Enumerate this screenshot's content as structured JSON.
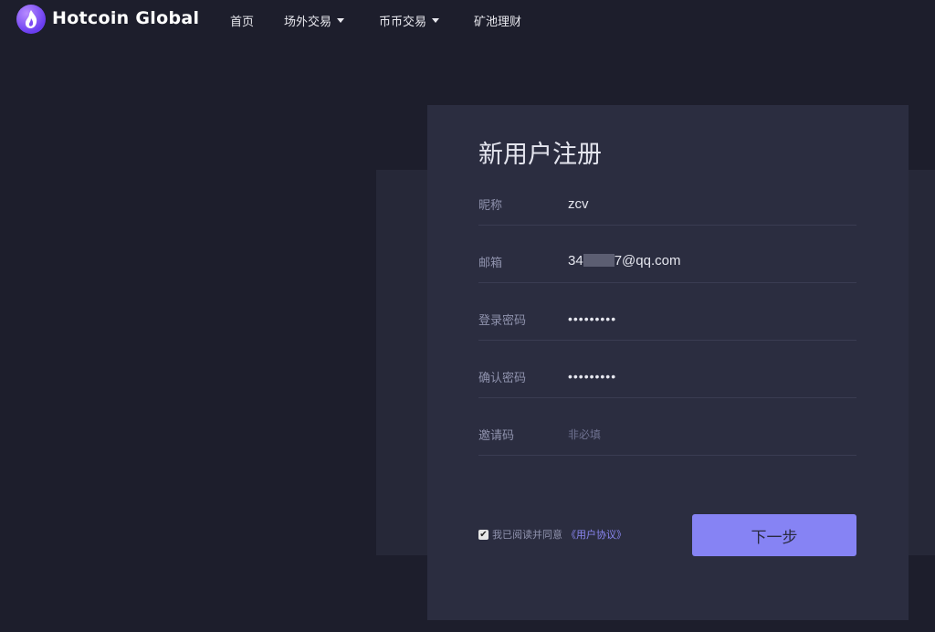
{
  "header": {
    "brand": "Hotcoin Global",
    "logo_icon": "flame-drop-icon",
    "nav": [
      {
        "label": "首页",
        "has_dropdown": false
      },
      {
        "label": "场外交易",
        "has_dropdown": true
      },
      {
        "label": "币币交易",
        "has_dropdown": true
      },
      {
        "label": "矿池理财",
        "has_dropdown": false
      }
    ]
  },
  "form": {
    "title": "新用户注册",
    "nickname": {
      "label": "昵称",
      "value": "zcv"
    },
    "email": {
      "label": "邮箱",
      "value_prefix": "34",
      "value_suffix": "7@qq.com",
      "masked": true
    },
    "password": {
      "label": "登录密码",
      "value": "•••••••••"
    },
    "confirm_password": {
      "label": "确认密码",
      "value": "•••••••••"
    },
    "invite_code": {
      "label": "邀请码",
      "value": "",
      "placeholder": "非必填"
    },
    "agreement": {
      "checked": true,
      "text": "我已阅读并同意",
      "link": "《用户协议》"
    },
    "next_button": "下一步"
  },
  "colors": {
    "page_bg": "#1d1e2c",
    "card_bg": "#2b2d40",
    "accent": "#8683f4"
  }
}
